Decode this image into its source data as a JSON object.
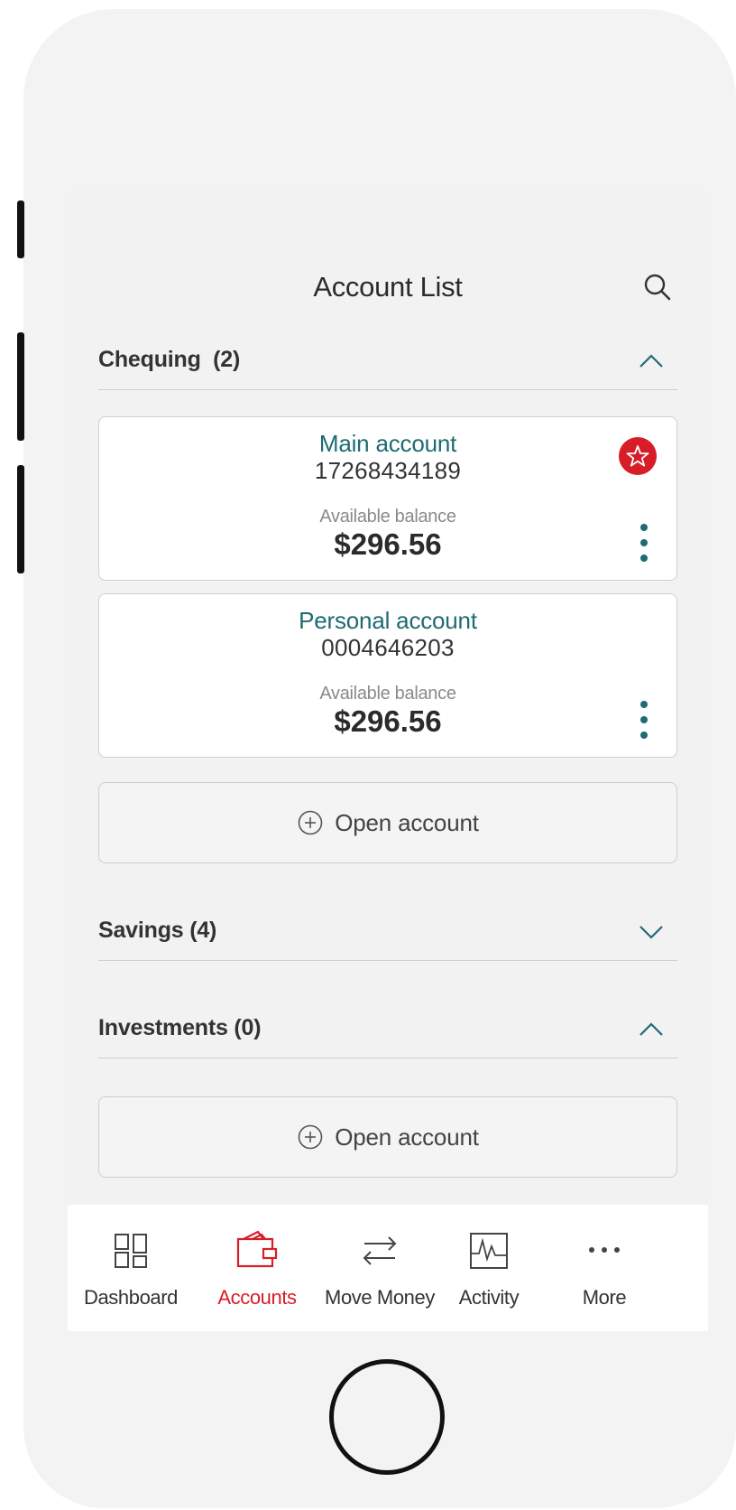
{
  "header": {
    "title": "Account List",
    "search_icon": "search-icon"
  },
  "sections": {
    "chequing": {
      "title": "Chequing",
      "count": "(2)",
      "expanded": true,
      "accounts": [
        {
          "name": "Main account",
          "number": "17268434189",
          "balance_label": "Available balance",
          "balance": "$296.56",
          "favorite": true
        },
        {
          "name": "Personal account",
          "number": "0004646203",
          "balance_label": "Available balance",
          "balance": "$296.56",
          "favorite": false
        }
      ],
      "open_account_label": "Open account"
    },
    "savings": {
      "title": "Savings (4)",
      "expanded": false
    },
    "investments": {
      "title": "Investments (0)",
      "expanded": true,
      "open_account_label": "Open account"
    }
  },
  "tabs": [
    {
      "label": "Dashboard",
      "icon": "dashboard-icon",
      "active": false
    },
    {
      "label": "Accounts",
      "icon": "wallet-icon",
      "active": true
    },
    {
      "label": "Move Money",
      "icon": "transfer-arrows-icon",
      "active": false
    },
    {
      "label": "Activity",
      "icon": "activity-chart-icon",
      "active": false
    },
    {
      "label": "More",
      "icon": "more-dots-icon",
      "active": false
    }
  ],
  "colors": {
    "accent_red": "#d71e28",
    "teal": "#1f6b72",
    "background": "#f2f2f2"
  }
}
